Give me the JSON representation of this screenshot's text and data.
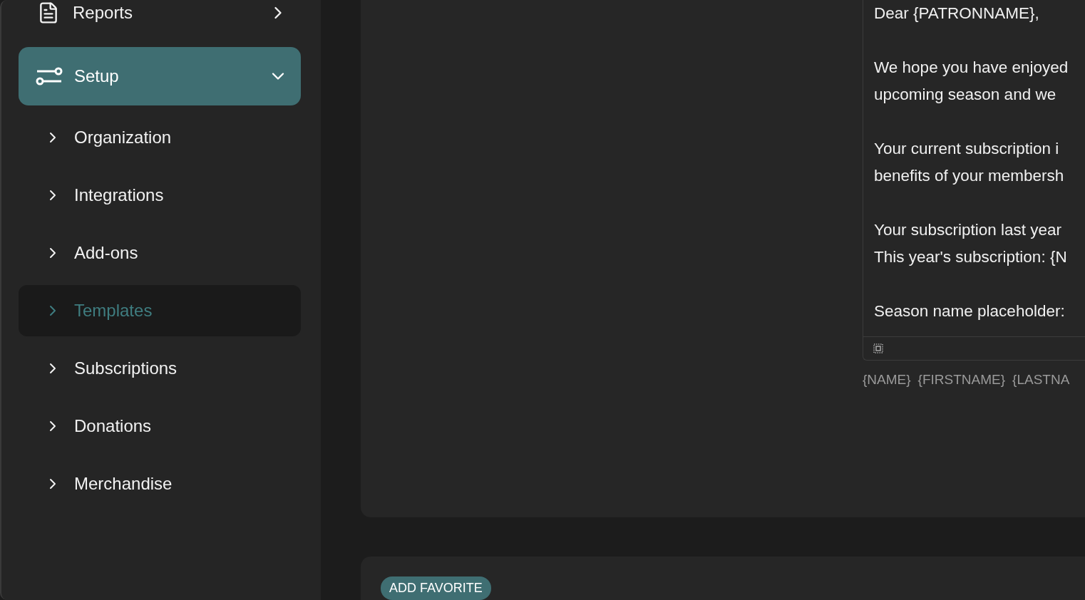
{
  "sidebar": {
    "top_item": {
      "label": "Reports",
      "expanded": false
    },
    "section": {
      "label": "Setup",
      "expanded": true
    },
    "items": [
      {
        "label": "Organization",
        "selected": false
      },
      {
        "label": "Integrations",
        "selected": false
      },
      {
        "label": "Add-ons",
        "selected": false
      },
      {
        "label": "Templates",
        "selected": true
      },
      {
        "label": "Subscriptions",
        "selected": false
      },
      {
        "label": "Donations",
        "selected": false
      },
      {
        "label": "Merchandise",
        "selected": false
      }
    ]
  },
  "editor": {
    "paragraphs": [
      [
        "Dear {PATRONNAME},"
      ],
      [
        "We hope you have enjoyed",
        "upcoming season and we"
      ],
      [
        "Your current subscription i",
        "benefits of your membersh"
      ],
      [
        "Your subscription last year",
        "This year's subscription: {N"
      ],
      [
        "Season name placeholder:"
      ]
    ],
    "tags": [
      "{NAME}",
      "{FIRSTNAME}",
      "{LASTNA"
    ]
  },
  "favorites": {
    "button": "ADD FAVORITE"
  }
}
